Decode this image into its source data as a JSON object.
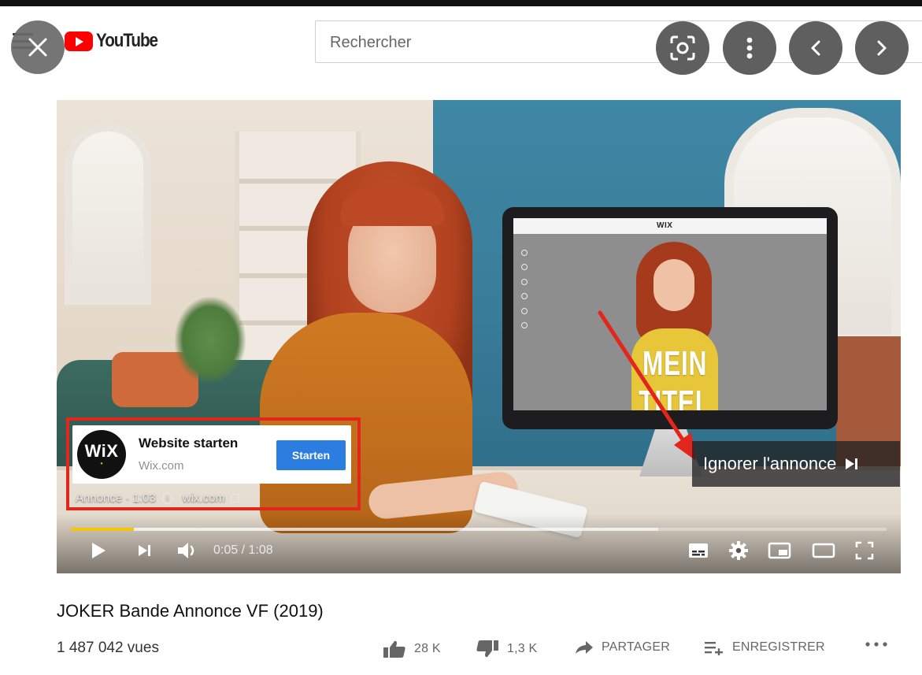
{
  "header": {
    "logo_text": "YouTube",
    "search_placeholder": "Rechercher"
  },
  "overlay_buttons": [
    "close-icon",
    "lens-icon",
    "more-vertical-icon",
    "chevron-left-icon",
    "chevron-right-icon"
  ],
  "video": {
    "screen_text": "MEIN TITEL",
    "monitor_brand": "WIX",
    "progress_fraction": 0.077,
    "buffer_fraction": 0.72
  },
  "ad": {
    "logo_text": "WiX",
    "title": "Website starten",
    "domain": "Wix.com",
    "cta_label": "Starten",
    "meta_label": "Annonce · 1:03",
    "meta_domain": "wix.com",
    "skip_label": "Ignorer l'annonce"
  },
  "player": {
    "time": "0:05 / 1:08"
  },
  "details": {
    "title": "JOKER Bande Annonce VF (2019)",
    "views": "1 487 042 vues",
    "likes": "28 K",
    "dislikes": "1,3 K",
    "share_label": "PARTAGER",
    "save_label": "ENREGISTRER"
  },
  "colors": {
    "youtube_red": "#ff0000",
    "annotation_red": "#e3261b",
    "ad_button_blue": "#2b7de0",
    "ad_progress_yellow": "#f6c400"
  }
}
